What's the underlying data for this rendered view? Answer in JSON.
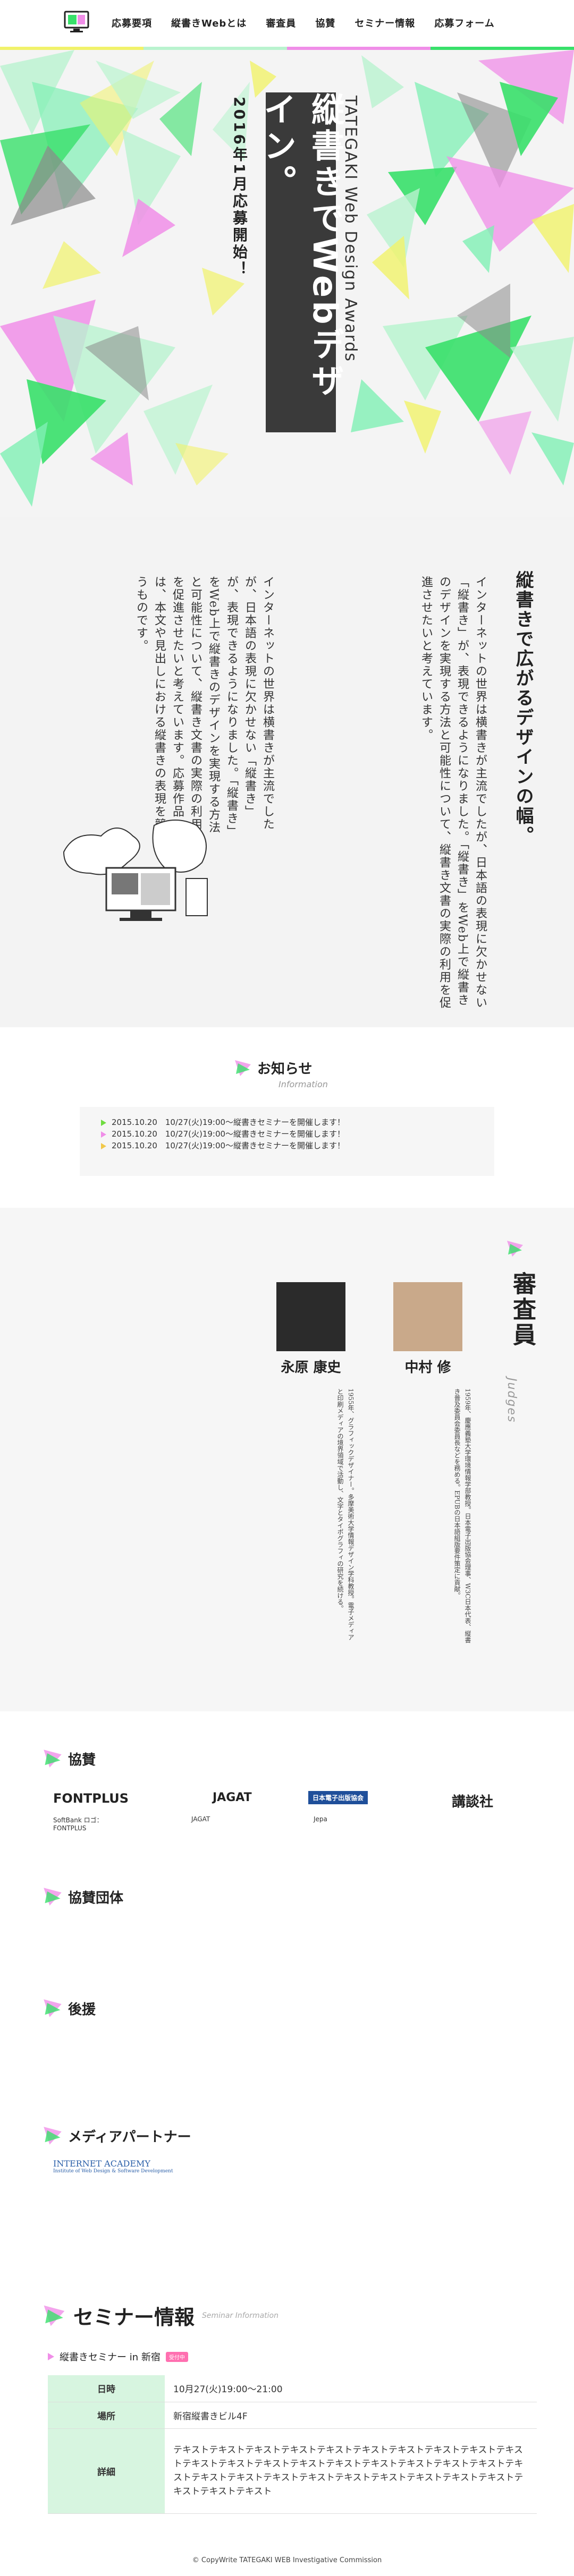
{
  "nav": {
    "items": [
      "応募要項",
      "縦書きWebとは",
      "審査員",
      "協賛",
      "セミナー情報",
      "応募フォーム"
    ]
  },
  "hero": {
    "title": "縦書きでWebデザイン。",
    "subtitle_en": "TATEGAKI Web Design Awards",
    "announcement": "2016年1月応募開始！"
  },
  "intro": {
    "heading": "縦書きで広がるデザインの幅。",
    "paragraph1": "インターネットの世界は横書きが主流でしたが、日本語の表現に欠かせない「縦書き」が、表現できるようになりました。「縦書き」をWeb上で縦書きのデザインを実現する方法と可能性について、縦書き文書の実際の利用を促進させたいと考えています。",
    "paragraph2": "インターネットの世界は横書きが主流でしたが、日本語の表現に欠かせない「縦書き」が、表現できるようになりました。「縦書き」をWeb上で縦書きのデザインを実現する方法と可能性について、縦書き文書の実際の利用を促進させたいと考えています。応募作品は、本文や見出しにおける縦書きの表現を競うものです。"
  },
  "news": {
    "title": "お知らせ",
    "title_en": "Information",
    "items": [
      "2015.10.20　10/27(火)19:00〜縦書きセミナーを開催します！",
      "2015.10.20　10/27(火)19:00〜縦書きセミナーを開催します！",
      "2015.10.20　10/27(火)19:00〜縦書きセミナーを開催します！"
    ]
  },
  "judges": {
    "title": "審査員",
    "title_en": "Judges",
    "people": [
      {
        "name": "中村 修",
        "bio": "1959年、慶應義塾大学環境情報学部教授。日本電子出版協会理事、W3C日本代表、縦書き普及委員会委員長などを務める。EPUBの日本語組版要件策定に貢献。"
      },
      {
        "name": "永原 康史",
        "bio": "1955年、グラフィックデザイナー。多摩美術大学情報デザイン学科教授。電子メディアと印刷メディアの境界領域で活動し、文字とタイポグラフィの研究を続ける。"
      }
    ]
  },
  "sponsors": {
    "title": "協賛",
    "logos": [
      {
        "name": "FONTPLUS",
        "label": "SoftBank ロゴ：FONTPLUS"
      },
      {
        "name": "JAGAT",
        "label": "JAGAT"
      },
      {
        "name": "日本電子出版協会",
        "label": "Jepa"
      },
      {
        "name": "講談社",
        "label": ""
      }
    ],
    "cooperation_title": "協賛団体",
    "support_title": "後援",
    "media_title": "メディアパートナー",
    "media_logo": "INTERNET ACADEMY",
    "media_logo_sub": "Institute of Web Design & Software Development"
  },
  "seminar": {
    "title": "セミナー情報",
    "title_en": "Seminar Information",
    "event_title": "縦書きセミナー in 新宿",
    "tag": "受付中",
    "rows": [
      {
        "key": "日時",
        "value": "10月27(火)19:00〜21:00"
      },
      {
        "key": "場所",
        "value": "新宿縦書きビル4F"
      },
      {
        "key": "詳細",
        "value": "テキストテキストテキストテキストテキストテキストテキストテキストテキストテキストテキストテキストテキストテキストテキストテキストテキストテキストテキストテキストテキストテキストテキストテキストテキストテキストテキストテキストテキストテキストテキストテキスト"
      }
    ]
  },
  "footer": {
    "copyright": "© CopyWrite TATEGAKI WEB Investigative Commission"
  },
  "colors": {
    "green": "#38e06a",
    "pink": "#f08ee8",
    "yellow": "#f1f26a",
    "grey": "#8a8a8a",
    "mint": "#b9f3cf"
  }
}
